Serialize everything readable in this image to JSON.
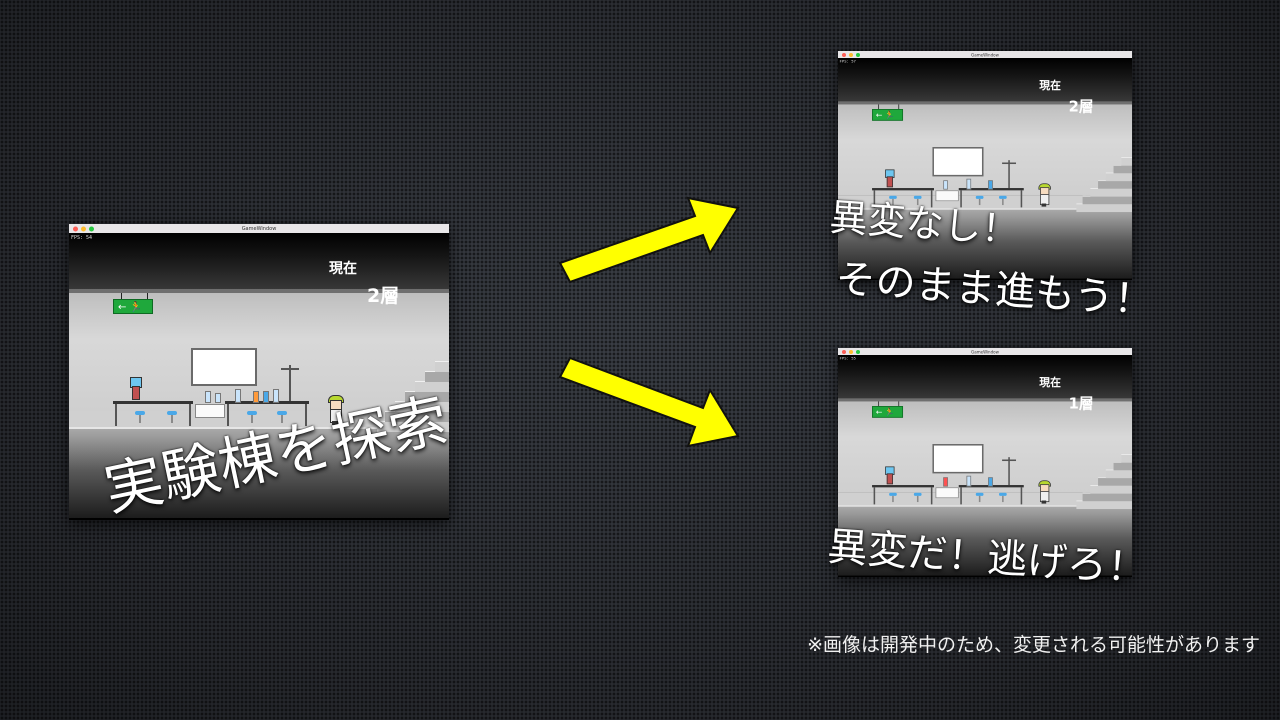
{
  "window": {
    "title": "GameWindow"
  },
  "main_shot": {
    "fps_text": "FPS: 54",
    "location_label": "現在",
    "floor_label": "2層"
  },
  "shot_normal": {
    "fps_text": "FPS: 57",
    "location_label": "現在",
    "floor_label": "2層"
  },
  "shot_anomaly": {
    "fps_text": "FPS: 55",
    "location_label": "現在",
    "floor_label": "1層"
  },
  "captions": {
    "explore": "実験棟を探索",
    "no_anomaly_line1": "異変なし！",
    "no_anomaly_line2": "そのまま進もう！",
    "anomaly": "異変だ！逃げろ！"
  },
  "note": "※画像は開発中のため、変更される可能性があります",
  "colors": {
    "arrow_fill": "#ffff00",
    "exit_sign": "#1fa83c",
    "stool": "#4aa8e8",
    "cap": "#b8d830"
  },
  "icons": [
    "emergency-exit-icon",
    "arrow-right-icon"
  ]
}
